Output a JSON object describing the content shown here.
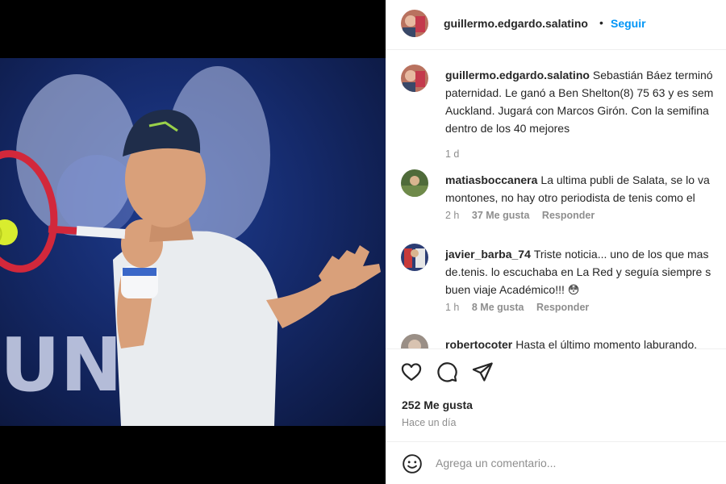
{
  "post": {
    "author": "guillermo.edgardo.salatino",
    "dot": "•",
    "follow_label": "Seguir",
    "photo_alt": "",
    "banner_text": "UNI"
  },
  "caption": {
    "username": "guillermo.edgardo.salatino",
    "lines": [
      "Sebastián Báez terminó",
      "paternidad. Le ganó a Ben Shelton(8) 75 63 y es sem",
      "Auckland. Jugará con Marcos Girón. Con la semifina",
      "dentro de los 40 mejores"
    ],
    "time": "1 d"
  },
  "comments": [
    {
      "username": "matiasboccanera",
      "lines": [
        "La ultima publi de Salata, se lo va",
        "montones, no hay otro periodista de tenis como el"
      ],
      "time": "2 h",
      "likes": "37 Me gusta",
      "reply": "Responder"
    },
    {
      "username": "javier_barba_74",
      "lines": [
        "Triste noticia... uno de los que mas",
        "de.tenis. lo escuchaba en La Red y seguía siempre s",
        "buen viaje Académico!!! 😳"
      ],
      "time": "1 h",
      "likes": "8 Me gusta",
      "reply": "Responder"
    },
    {
      "username": "robertocoter",
      "lines": [
        "Hasta el último momento laburando."
      ]
    }
  ],
  "actions": {
    "like_icon": "heart-icon",
    "comment_icon": "comment-icon",
    "share_icon": "share-icon",
    "likes_count": "252 Me gusta",
    "time_ago": "Hace un día"
  },
  "add_comment": {
    "emoji_icon": "emoji-icon",
    "placeholder": "Agrega un comentario..."
  },
  "colors": {
    "accent": "#0095f6",
    "muted": "#8e8e8e",
    "text": "#262626"
  }
}
